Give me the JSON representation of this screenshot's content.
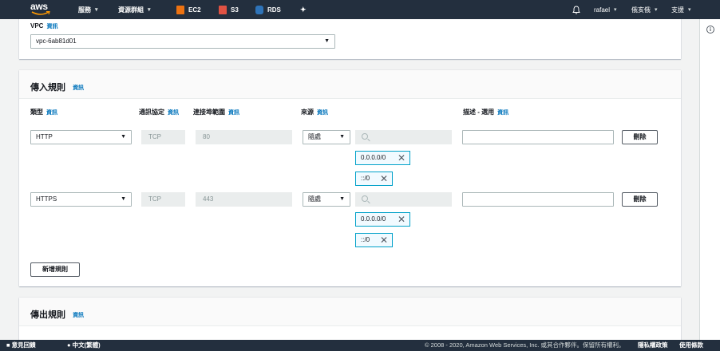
{
  "nav": {
    "services": "服務",
    "resource_groups": "資源群組",
    "ec2": "EC2",
    "s3": "S3",
    "rds": "RDS",
    "user": "rafael",
    "region": "俄亥俄",
    "support": "支援",
    "colors": {
      "ec2": "#ec7211",
      "s3": "#e05243",
      "rds": "#2e73b8"
    }
  },
  "vpc": {
    "label": "VPC",
    "info": "資訊",
    "value": "vpc-6ab81d01"
  },
  "inbound": {
    "title": "傳入規則",
    "info": "資訊",
    "headers": {
      "type": "類型",
      "protocol": "通訊協定",
      "port_range": "連接埠範圍",
      "source": "來源",
      "description": "描述 - 選用",
      "info": "資訊"
    },
    "rules": [
      {
        "type": "HTTP",
        "protocol": "TCP",
        "port": "80",
        "source": "隨處",
        "tokens": [
          "0.0.0.0/0",
          "::/0"
        ],
        "delete": "刪除"
      },
      {
        "type": "HTTPS",
        "protocol": "TCP",
        "port": "443",
        "source": "隨處",
        "tokens": [
          "0.0.0.0/0",
          "::/0"
        ],
        "delete": "刪除"
      }
    ],
    "add_rule": "新增規則"
  },
  "outbound": {
    "title": "傳出規則",
    "info": "資訊"
  },
  "footer": {
    "feedback": "意見回饋",
    "language": "中文(繁體)",
    "copyright": "© 2008 - 2020, Amazon Web Services, Inc. 或其合作夥伴。保留所有權利。",
    "privacy": "隱私權政策",
    "terms": "使用條款"
  }
}
